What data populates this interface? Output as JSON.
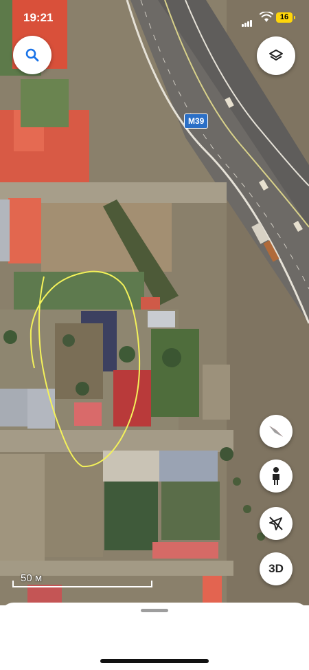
{
  "status_bar": {
    "time": "19:21",
    "battery": "16"
  },
  "map": {
    "road_shield": "M39",
    "scale_label": "50 м"
  },
  "controls": {
    "search_icon": "search-icon",
    "layers_icon": "layers-icon",
    "compass_icon": "compass-icon",
    "pegman_icon": "pegman-icon",
    "location_icon": "location-arrow-off-icon",
    "view_3d_label": "3D"
  },
  "colors": {
    "shield": "#2b6fc6",
    "annotation": "#f4f25a",
    "accent": "#1a73e8"
  }
}
